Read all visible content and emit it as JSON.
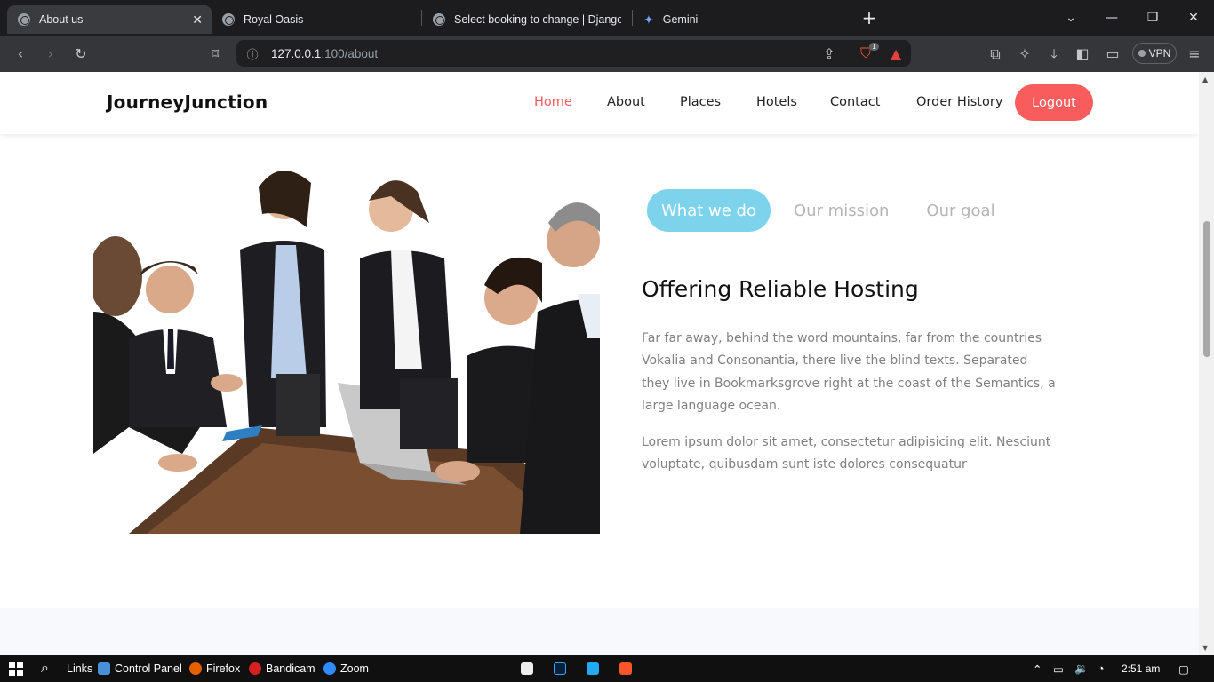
{
  "browser": {
    "tabs": [
      {
        "title": "About us",
        "active": true
      },
      {
        "title": "Royal Oasis",
        "active": false
      },
      {
        "title": "Select booking to change | Django si",
        "active": false
      },
      {
        "title": "Gemini",
        "active": false
      }
    ],
    "url_host": "127.0.0.1",
    "url_path": ":100/about",
    "vpn_label": "VPN",
    "brave_badge": "1"
  },
  "site": {
    "brand": "JourneyJunction",
    "nav": [
      {
        "label": "Home",
        "active": true
      },
      {
        "label": "About",
        "active": false
      },
      {
        "label": "Places",
        "active": false
      },
      {
        "label": "Hotels",
        "active": false
      },
      {
        "label": "Contact",
        "active": false
      },
      {
        "label": "Order History",
        "active": false
      }
    ],
    "logout_label": "Logout",
    "accent_color": "#f85c5c"
  },
  "about": {
    "tabs": [
      {
        "label": "What we do",
        "active": true
      },
      {
        "label": "Our mission",
        "active": false
      },
      {
        "label": "Our goal",
        "active": false
      }
    ],
    "active_tab_color": "#7dd3ec",
    "heading": "Offering Reliable Hosting",
    "paragraph1": "Far far away, behind the word mountains, far from the countries Vokalia and Consonantia, there live the blind texts. Separated they live in Bookmarksgrove right at the coast of the Semantics, a large language ocean.",
    "paragraph2": "Lorem ipsum dolor sit amet, consectetur adipisicing elit. Nesciunt voluptate, quibusdam sunt iste dolores consequatur"
  },
  "taskbar": {
    "items": [
      "Links",
      "Control Panel",
      "Firefox",
      "Bandicam",
      "Zoom"
    ],
    "time": "2:51 am"
  }
}
